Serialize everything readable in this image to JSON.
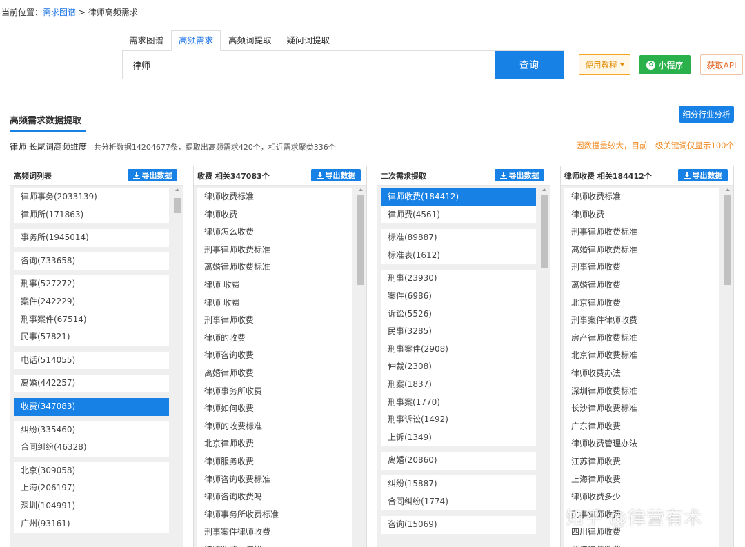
{
  "breadcrumb": {
    "prefix": "当前位置：",
    "link": "需求图谱",
    "sep": " > ",
    "current": "律师高频需求"
  },
  "tabs": [
    "需求图谱",
    "高频需求",
    "高频词提取",
    "疑问词提取"
  ],
  "active_tab": 1,
  "search": {
    "value": "律师",
    "button": "查询"
  },
  "buttons": {
    "tutorial": "使用教程",
    "mini_program": "小程序",
    "api": "获取API",
    "industry": "细分行业分析",
    "export": "导出数据"
  },
  "panel": {
    "title": "高频需求数据提取",
    "summary_main": "律师 长尾词高频维度",
    "summary_sub": "共分析数据14204677条，提取出高频需求420个，相近需求聚类336个",
    "notice": "因数据量较大，目前二级关键词仅显示100个"
  },
  "columns": [
    {
      "title": "高频词列表",
      "groups": [
        [
          "律师事务(2033139)",
          "律师所(171863)"
        ],
        [
          "事务所(1945014)"
        ],
        [
          "咨询(733658)"
        ],
        [
          "刑事(527272)",
          "案件(242229)",
          "刑事案件(67514)",
          "民事(57821)"
        ],
        [
          "电话(514055)"
        ],
        [
          "离婚(442257)"
        ],
        [
          "收费(347083)"
        ],
        [
          "纠纷(335460)",
          "合同纠纷(46328)"
        ],
        [
          "北京(309058)",
          "上海(206197)",
          "深圳(104991)",
          "广州(93161)"
        ]
      ],
      "selected": "收费(347083)"
    },
    {
      "title": "收费 相关347083个",
      "items": [
        "律师收费标准",
        "律师收费",
        "律师怎么收费",
        "刑事律师收费标准",
        "离婚律师收费标准",
        "律师 收费",
        "律师  收费",
        "刑事律师收费",
        "律师的收费",
        "律师咨询收费",
        "离婚律师收费",
        "律师事务所收费",
        "律师如何收费",
        "律师的收费标准",
        "北京律师收费",
        "律师服务收费",
        "律师咨询收费标准",
        "律师咨询收费吗",
        "律师事务所收费标准",
        "刑事案件律师收费",
        "律师收费是怎样"
      ]
    },
    {
      "title": "二次需求提取",
      "groups": [
        [
          "律师收费(184412)",
          "律师费(4561)"
        ],
        [
          "标准(89887)",
          "标准表(1612)"
        ],
        [
          "刑事(23930)",
          "案件(6986)",
          "诉讼(5526)",
          "民事(3285)",
          "刑事案件(2908)",
          "仲裁(2308)",
          "刑案(1837)",
          "刑事案(1770)",
          "刑事诉讼(1492)",
          "上诉(1349)"
        ],
        [
          "离婚(20860)"
        ],
        [
          "纠纷(15887)",
          "合同纠纷(1774)"
        ],
        [
          "咨询(15069)"
        ]
      ],
      "selected": "律师收费(184412)"
    },
    {
      "title": "律师收费 相关184412个",
      "items": [
        "律师收费标准",
        "律师收费",
        "刑事律师收费标准",
        "离婚律师收费标准",
        "刑事律师收费",
        "离婚律师收费",
        "北京律师收费",
        "刑事案件律师收费",
        "房产律师收费标准",
        "北京律师收费标准",
        "律师收费办法",
        "深圳律师收费标准",
        "长沙律师收费标准",
        "广东律师收费",
        "律师收费管理办法",
        "江苏律师收费",
        "上海律师收费",
        "律师收费多少",
        "民事律师收费",
        "四川律师收费",
        "浙江律师收费"
      ]
    }
  ],
  "watermark": "知乎 @律营有术"
}
